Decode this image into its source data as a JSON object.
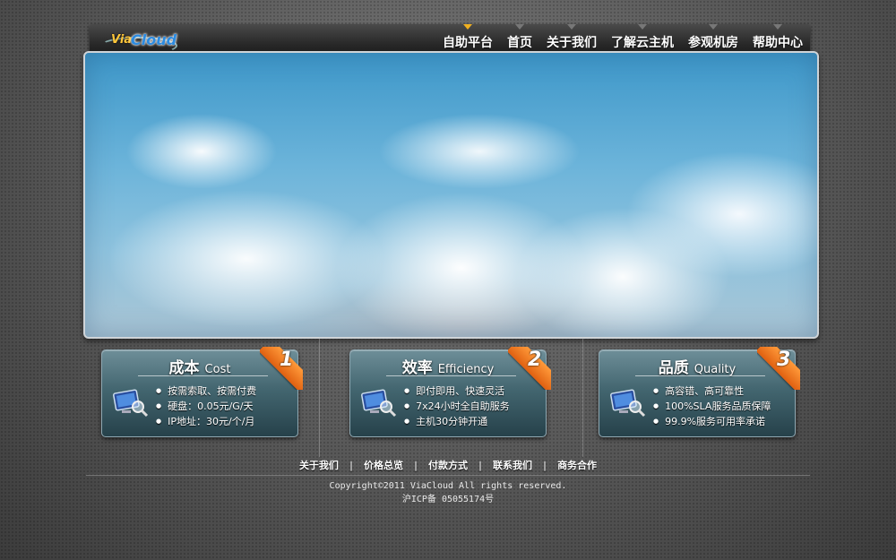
{
  "brand": {
    "logo_via": "Via",
    "logo_cloud": "Cloud"
  },
  "nav": {
    "items": [
      {
        "label": "自助平台",
        "active": true
      },
      {
        "label": "首页",
        "active": false
      },
      {
        "label": "关于我们",
        "active": false
      },
      {
        "label": "了解云主机",
        "active": false
      },
      {
        "label": "参观机房",
        "active": false
      },
      {
        "label": "帮助中心",
        "active": false
      }
    ]
  },
  "features": [
    {
      "title_cn": "成本",
      "title_en": "Cost",
      "number": "1",
      "bullets": [
        "按需索取、按需付费",
        "硬盘：0.05元/G/天",
        "IP地址：30元/个/月"
      ]
    },
    {
      "title_cn": "效率",
      "title_en": "Efficiency",
      "number": "2",
      "bullets": [
        "即付即用、快速灵活",
        "7x24小时全自助服务",
        "主机30分钟开通"
      ]
    },
    {
      "title_cn": "品质",
      "title_en": "Quality",
      "number": "3",
      "bullets": [
        "高容错、高可靠性",
        "100%SLA服务品质保障",
        "99.9%服务可用率承诺"
      ]
    }
  ],
  "footer": {
    "links": [
      "关于我们",
      "价格总览",
      "付款方式",
      "联系我们",
      "商务合作"
    ],
    "separator": "|",
    "copyright": "Copyright©2011 ViaCloud All rights reserved.",
    "icp": "沪ICP备 05055174号"
  },
  "colors": {
    "accent": "#f0b020",
    "ribbon": "#ff8a2a",
    "card": "#436670"
  }
}
